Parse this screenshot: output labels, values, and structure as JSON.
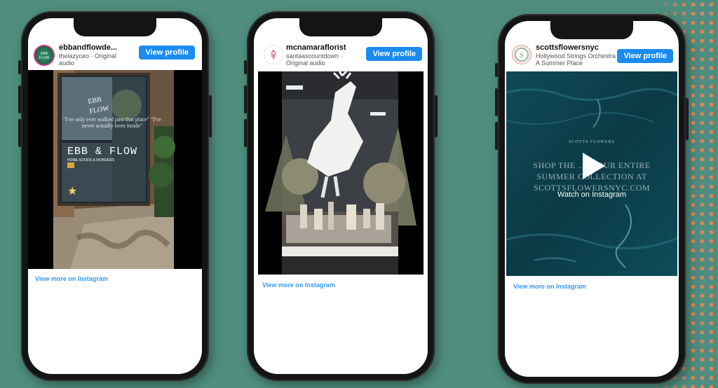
{
  "phones": [
    {
      "username": "ebbandflowde...",
      "subtitle": "thelazyceo · Original audio",
      "view_profile": "View profile",
      "more": "View more on Instagram",
      "store_sign": "EBB & FLOW",
      "store_sub": "HOME GOODS & WONDERS",
      "quote": "\"I've only ever walked past that place\" \"I've never actually been inside\""
    },
    {
      "username": "mcnamaraflorist",
      "subtitle": "santaascountdown · Original audio",
      "view_profile": "View profile",
      "more": "View more on Instagram"
    },
    {
      "username": "scottsflowersnyc",
      "subtitle": "Hollywood Strings Orchestra · A Summer Place",
      "view_profile": "View profile",
      "more": "View more on Instagram",
      "watch": "Watch on Instagram",
      "brand": "SCOTTS FLOWERS",
      "promo": "SHOP THE ... & OUR ENTIRE SUMMER COLLECTION AT SCOTTSFLOWERSNYC.COM"
    }
  ],
  "colors": {
    "background": "#4f8d7e",
    "button": "#1a8cf0",
    "link": "#3897f0",
    "dots": "#e8835e"
  }
}
